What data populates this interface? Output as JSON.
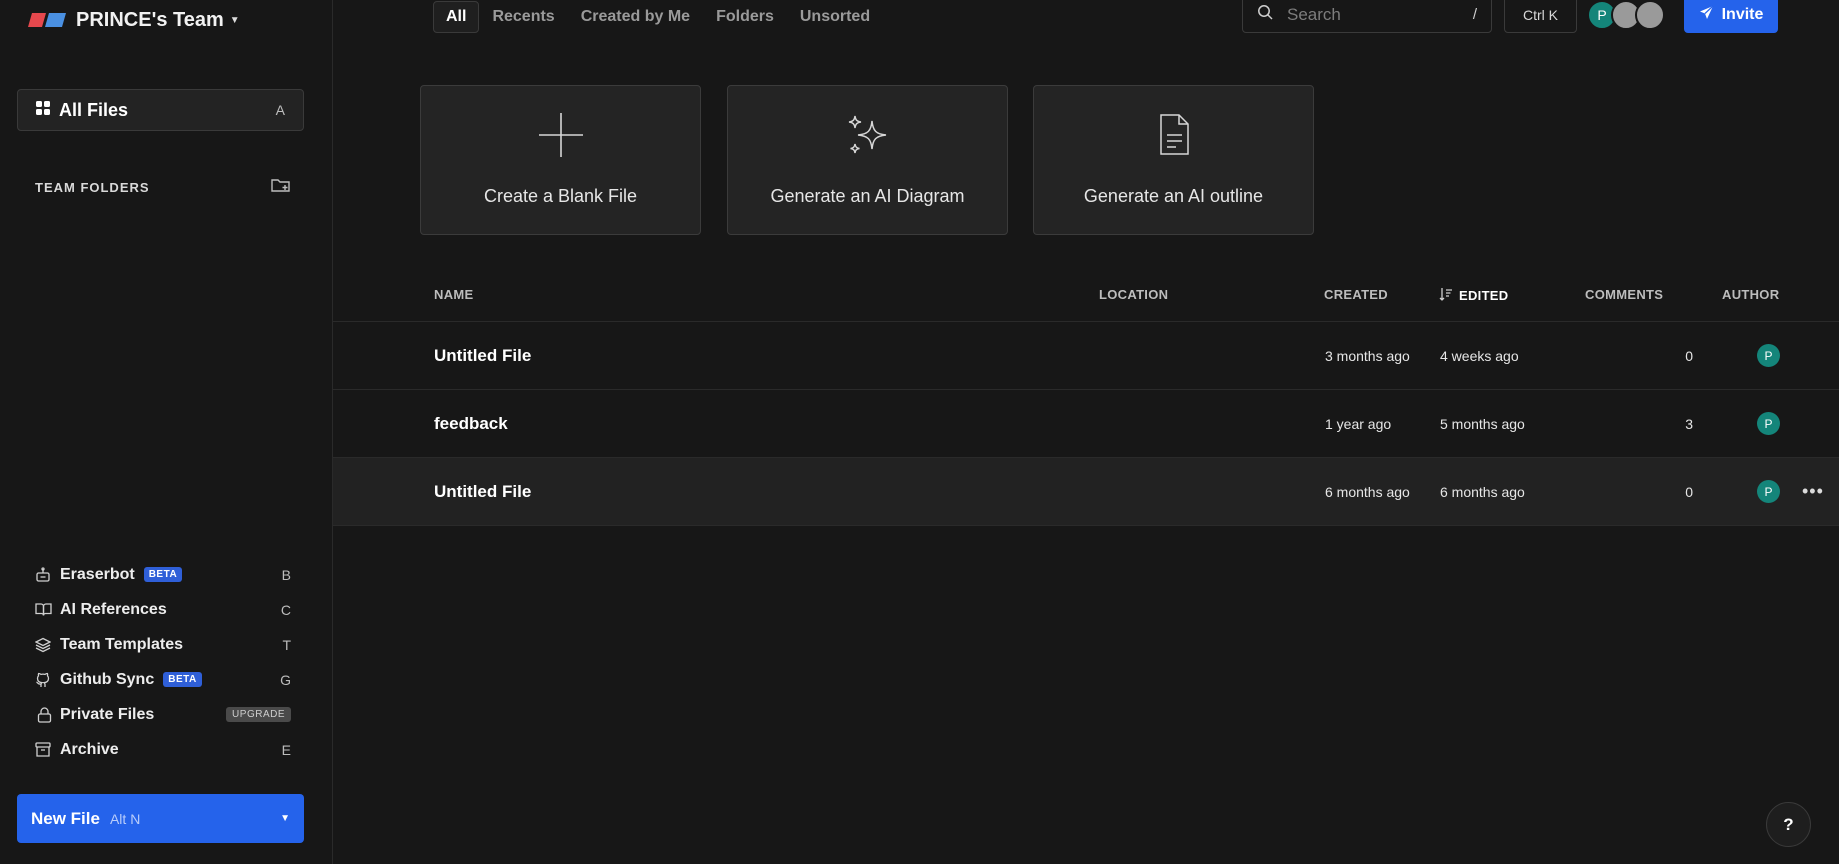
{
  "sidebar": {
    "team_name": "PRINCE's Team",
    "all_files": {
      "label": "All Files",
      "shortcut": "A"
    },
    "team_folders_label": "TEAM FOLDERS",
    "items": [
      {
        "label": "Eraserbot",
        "badge": "BETA",
        "shortcut": "B",
        "icon": "robot-icon"
      },
      {
        "label": "AI References",
        "badge": "",
        "shortcut": "C",
        "icon": "book-icon"
      },
      {
        "label": "Team Templates",
        "badge": "",
        "shortcut": "T",
        "icon": "layers-icon"
      },
      {
        "label": "Github Sync",
        "badge": "BETA",
        "shortcut": "G",
        "icon": "github-icon"
      },
      {
        "label": "Private Files",
        "badge": "UPGRADE",
        "shortcut": "",
        "icon": "lock-icon"
      },
      {
        "label": "Archive",
        "badge": "",
        "shortcut": "E",
        "icon": "archive-icon"
      }
    ],
    "new_file": {
      "label": "New File",
      "hint": "Alt N"
    }
  },
  "topbar": {
    "tabs": [
      "All",
      "Recents",
      "Created by Me",
      "Folders",
      "Unsorted"
    ],
    "active_tab": "All",
    "search_placeholder": "Search",
    "search_shortcut": "/",
    "command_shortcut": "Ctrl K",
    "avatar_initial": "P",
    "invite_label": "Invite"
  },
  "cards": [
    {
      "label": "Create a Blank File",
      "icon": "plus-icon"
    },
    {
      "label": "Generate an AI Diagram",
      "icon": "sparkles-icon"
    },
    {
      "label": "Generate an AI outline",
      "icon": "document-icon"
    }
  ],
  "table": {
    "headers": {
      "name": "NAME",
      "location": "LOCATION",
      "created": "CREATED",
      "edited": "EDITED",
      "comments": "COMMENTS",
      "author": "AUTHOR"
    },
    "rows": [
      {
        "name": "Untitled File",
        "created": "3 months ago",
        "edited": "4 weeks ago",
        "comments": "0",
        "author": "P"
      },
      {
        "name": "feedback",
        "created": "1 year ago",
        "edited": "5 months ago",
        "comments": "3",
        "author": "P"
      },
      {
        "name": "Untitled File",
        "created": "6 months ago",
        "edited": "6 months ago",
        "comments": "0",
        "author": "P"
      }
    ]
  },
  "help_label": "?",
  "colors": {
    "accent": "#2563eb",
    "avatar": "#14857a",
    "background": "#171717"
  }
}
